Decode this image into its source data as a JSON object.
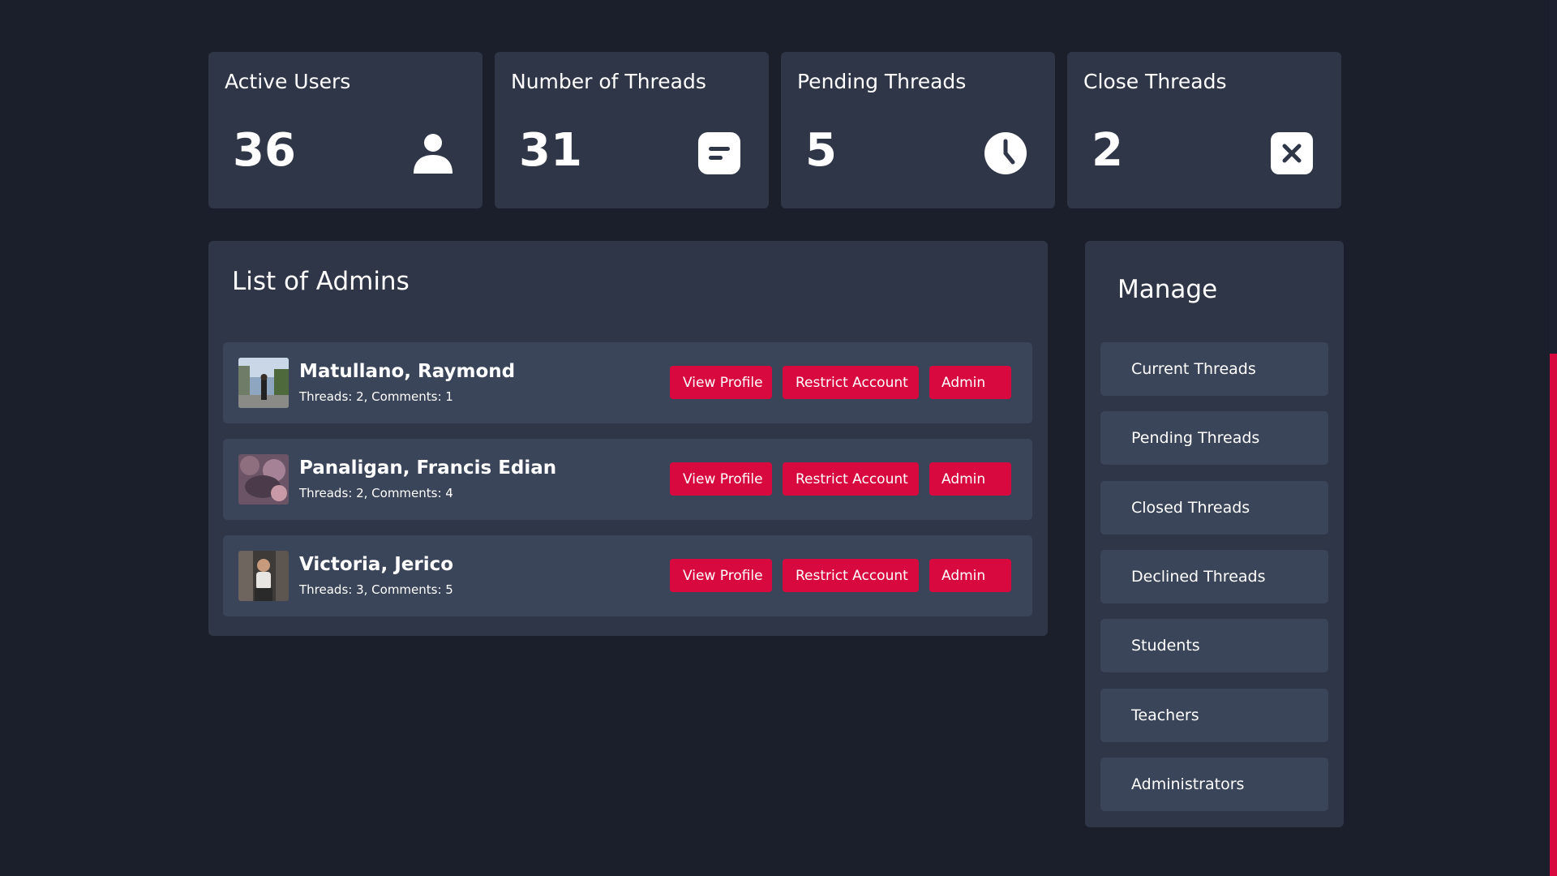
{
  "stats": [
    {
      "title": "Active Users",
      "value": "36",
      "icon": "user-icon"
    },
    {
      "title": "Number of Threads",
      "value": "31",
      "icon": "message-icon"
    },
    {
      "title": "Pending Threads",
      "value": "5",
      "icon": "clock-icon"
    },
    {
      "title": "Close Threads",
      "value": "2",
      "icon": "close-icon"
    }
  ],
  "admins": {
    "title": "List of Admins",
    "rows": [
      {
        "name": "Matullano, Raymond",
        "meta": "Threads: 2, Comments: 1"
      },
      {
        "name": "Panaligan, Francis Edian",
        "meta": "Threads: 2, Comments: 4"
      },
      {
        "name": "Victoria, Jerico",
        "meta": "Threads: 3, Comments: 5"
      }
    ],
    "actions": {
      "view_profile": "View Profile",
      "restrict_account": "Restrict Account",
      "admin": "Admin"
    }
  },
  "manage": {
    "title": "Manage",
    "items": [
      "Current Threads",
      "Pending Threads",
      "Closed Threads",
      "Declined Threads",
      "Students",
      "Teachers",
      "Administrators"
    ]
  },
  "colors": {
    "background": "#1b1f2b",
    "card": "#2e3648",
    "row": "#3b4559",
    "accent": "#d7093f"
  }
}
